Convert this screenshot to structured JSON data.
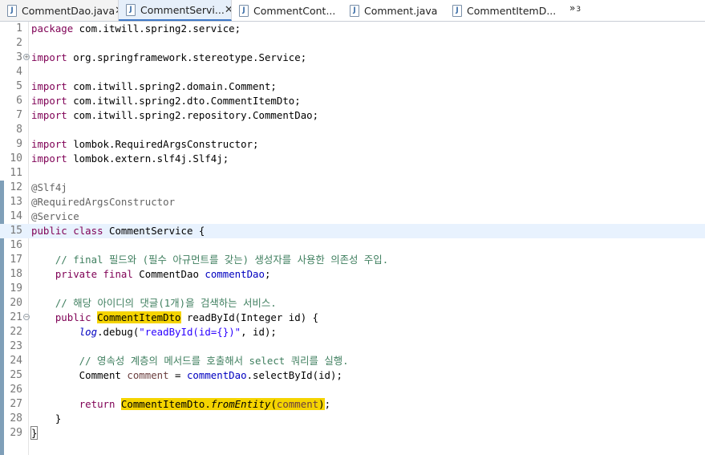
{
  "tabs": [
    {
      "label": "CommentDao.java",
      "has_close": true
    },
    {
      "label": "CommentServi...",
      "has_close": true,
      "active": true
    },
    {
      "label": "CommentCont..."
    },
    {
      "label": "Comment.java"
    },
    {
      "label": "CommentItemD..."
    }
  ],
  "overflow": {
    "icon": "chevron-double-right-icon",
    "symbol": "»",
    "count": "3"
  },
  "file_icon": "J",
  "lines": [
    {
      "n": "1",
      "code": "package com.itwill.spring2.service;"
    },
    {
      "n": "2",
      "code": ""
    },
    {
      "n": "3",
      "code": "import org.springframework.stereotype.Service;",
      "fold": true
    },
    {
      "n": "4",
      "code": ""
    },
    {
      "n": "5",
      "code": "import com.itwill.spring2.domain.Comment;"
    },
    {
      "n": "6",
      "code": "import com.itwill.spring2.dto.CommentItemDto;"
    },
    {
      "n": "7",
      "code": "import com.itwill.spring2.repository.CommentDao;"
    },
    {
      "n": "8",
      "code": ""
    },
    {
      "n": "9",
      "code": "import lombok.RequiredArgsConstructor;"
    },
    {
      "n": "10",
      "code": "import lombok.extern.slf4j.Slf4j;"
    },
    {
      "n": "11",
      "code": ""
    },
    {
      "n": "12",
      "code": "@Slf4j"
    },
    {
      "n": "13",
      "code": "@RequiredArgsConstructor"
    },
    {
      "n": "14",
      "code": "@Service"
    },
    {
      "n": "15",
      "code": "public class CommentService {",
      "current": true
    },
    {
      "n": "16",
      "code": ""
    },
    {
      "n": "17",
      "code": "    // final 필드와 (필수 아규먼트를 갖는) 생성자를 사용한 의존성 주입."
    },
    {
      "n": "18",
      "code": "    private final CommentDao commentDao;"
    },
    {
      "n": "19",
      "code": ""
    },
    {
      "n": "20",
      "code": "    // 해당 아이디의 댓글(1개)을 검색하는 서비스."
    },
    {
      "n": "21",
      "code": "    public CommentItemDto readById(Integer id) {",
      "fold": true
    },
    {
      "n": "22",
      "code": "        log.debug(\"readById(id={})\", id);"
    },
    {
      "n": "23",
      "code": ""
    },
    {
      "n": "24",
      "code": "        // 영속성 계층의 메서드를 호출해서 select 쿼리를 실행."
    },
    {
      "n": "25",
      "code": "        Comment comment = commentDao.selectById(id);"
    },
    {
      "n": "26",
      "code": ""
    },
    {
      "n": "27",
      "code": "        return CommentItemDto.fromEntity(comment);"
    },
    {
      "n": "28",
      "code": "    }"
    },
    {
      "n": "29",
      "code": "}"
    }
  ]
}
